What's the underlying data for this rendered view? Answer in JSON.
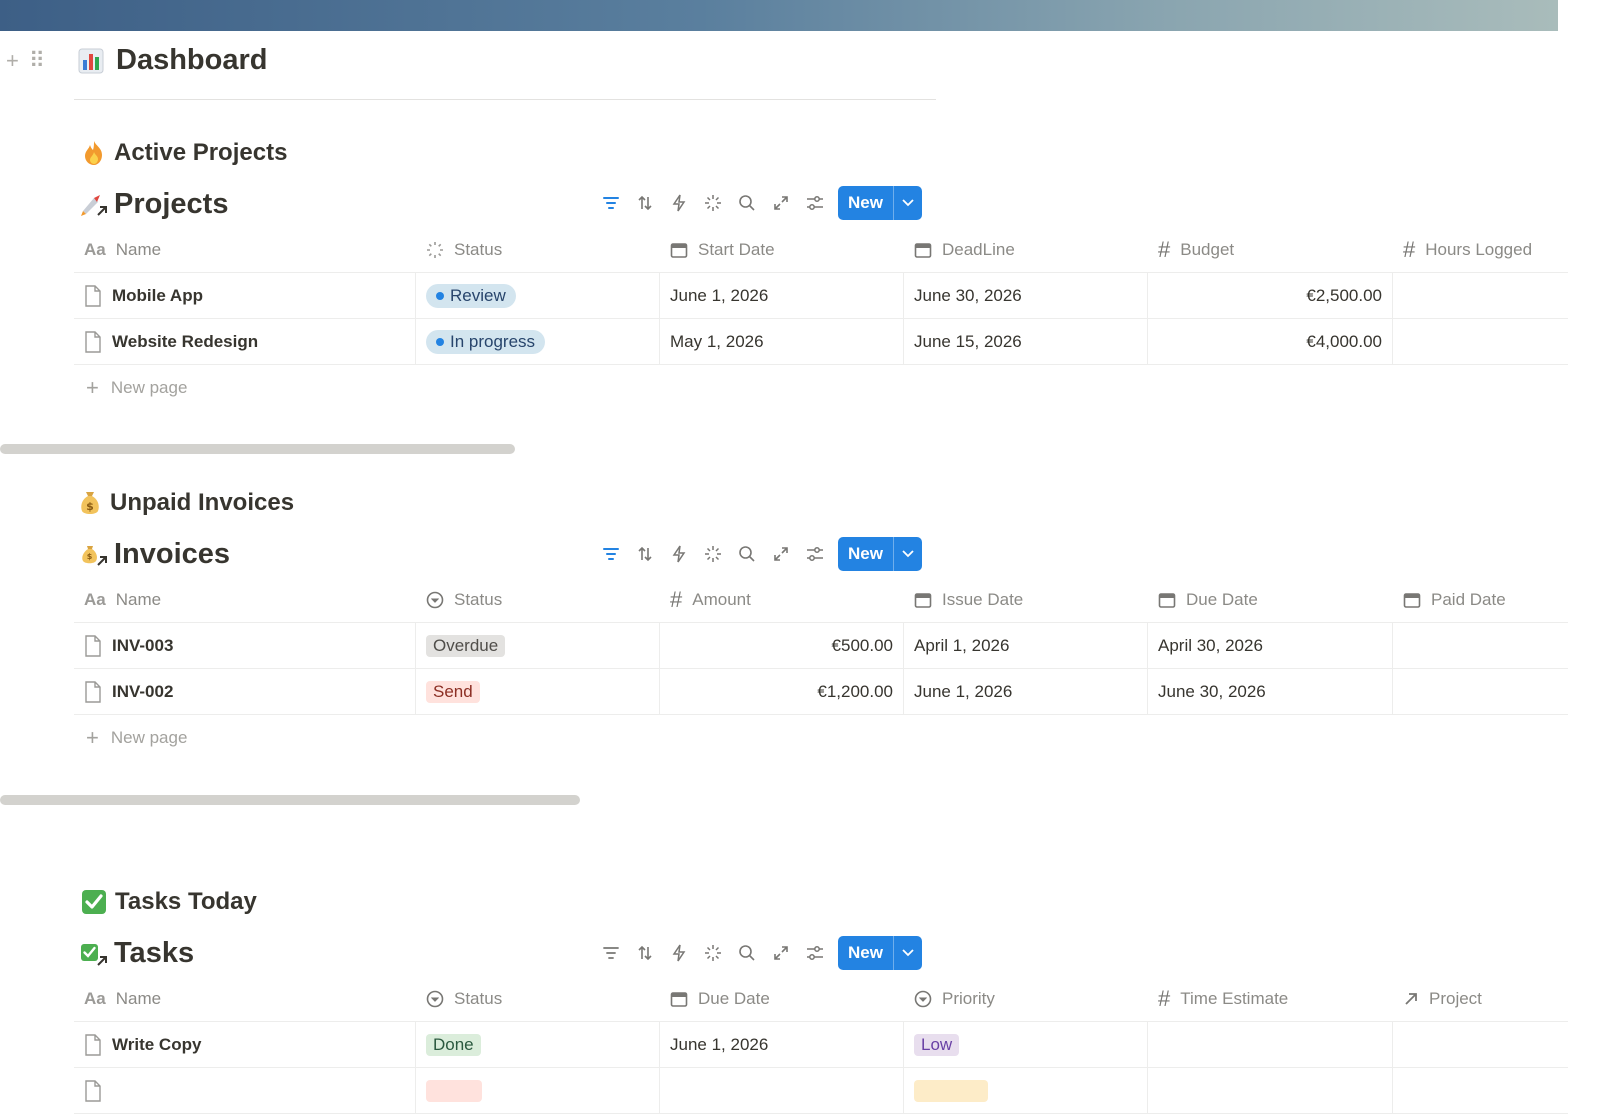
{
  "page": {
    "title": "Dashboard"
  },
  "sections": {
    "projects": {
      "heading": "Active Projects",
      "db_title": "Projects",
      "new_label": "New",
      "columns": [
        "Name",
        "Status",
        "Start Date",
        "DeadLine",
        "Budget",
        "Hours Logged"
      ],
      "rows": [
        {
          "name": "Mobile App",
          "status": "Review",
          "start": "June 1, 2026",
          "deadline": "June 30, 2026",
          "budget": "€2,500.00",
          "hours": ""
        },
        {
          "name": "Website Redesign",
          "status": "In progress",
          "start": "May 1, 2026",
          "deadline": "June 15, 2026",
          "budget": "€4,000.00",
          "hours": ""
        }
      ],
      "new_page": "New page"
    },
    "invoices": {
      "heading": "Unpaid Invoices",
      "db_title": "Invoices",
      "new_label": "New",
      "columns": [
        "Name",
        "Status",
        "Amount",
        "Issue Date",
        "Due Date",
        "Paid Date"
      ],
      "rows": [
        {
          "name": "INV-003",
          "status": "Overdue",
          "amount": "€500.00",
          "issue": "April 1, 2026",
          "due": "April 30, 2026",
          "paid": ""
        },
        {
          "name": "INV-002",
          "status": "Send",
          "amount": "€1,200.00",
          "issue": "June 1, 2026",
          "due": "June 30, 2026",
          "paid": ""
        }
      ],
      "new_page": "New page"
    },
    "tasks": {
      "heading": "Tasks Today",
      "db_title": "Tasks",
      "new_label": "New",
      "columns": [
        "Name",
        "Status",
        "Due Date",
        "Priority",
        "Time Estimate",
        "Project"
      ],
      "rows": [
        {
          "name": "Write Copy",
          "status": "Done",
          "due": "June 1, 2026",
          "priority": "Low",
          "estimate": "",
          "project": ""
        }
      ]
    }
  },
  "colors": {
    "accent": "#2383e2",
    "review_bg": "#d3e5ef",
    "in_progress_bg": "#d3e5ef",
    "overdue_bg": "#e3e2e0",
    "send_bg": "#ffe2dd",
    "done_bg": "#dbeddb",
    "low_bg": "#e8deee",
    "medium_bg": "#fdecc8"
  }
}
